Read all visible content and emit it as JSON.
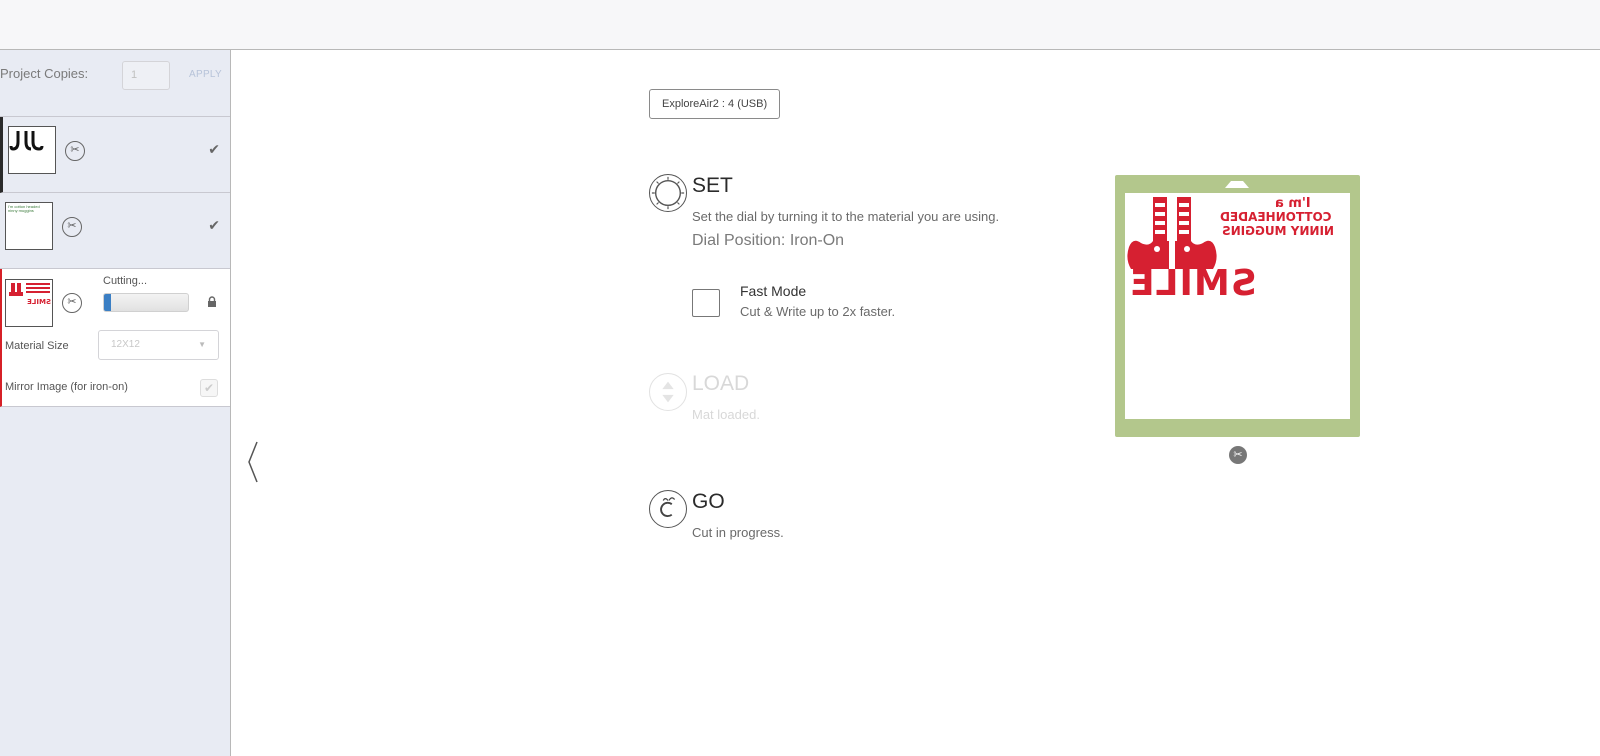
{
  "sidebar": {
    "copies_label": "Project Copies:",
    "copies_value": "1",
    "apply_label": "APPLY",
    "mats": [
      {
        "status": "done"
      },
      {
        "status": "done",
        "thumb_text": "I'm cotton headed ninny muggins"
      }
    ],
    "active_mat": {
      "status_label": "Cutting...",
      "progress": 0.08,
      "material_size_label": "Material Size",
      "material_size_value": "12X12",
      "mirror_label": "Mirror Image (for iron-on)",
      "mirror_checked": true
    }
  },
  "device": {
    "label": "ExploreAir2 : 4 (USB)"
  },
  "steps": {
    "set": {
      "title": "SET",
      "description": "Set the dial by turning it to the material you are using.",
      "dial_position": "Dial Position: Iron-On"
    },
    "fast_mode": {
      "title": "Fast Mode",
      "description": "Cut & Write up to 2x faster.",
      "checked": false
    },
    "load": {
      "title": "LOAD",
      "description": "Mat loaded."
    },
    "go": {
      "title": "GO",
      "description": "Cut in progress."
    }
  },
  "preview": {
    "mat_color": "#b3c78c",
    "design_color": "#d62031",
    "text_line1": "I'm a",
    "text_line2": "COTTONHEADED",
    "text_line3": "NINNY MUGGINS",
    "text_smile": "SMILE"
  },
  "colors": {
    "accent": "#3b7fc4",
    "active_border": "#d62027"
  }
}
